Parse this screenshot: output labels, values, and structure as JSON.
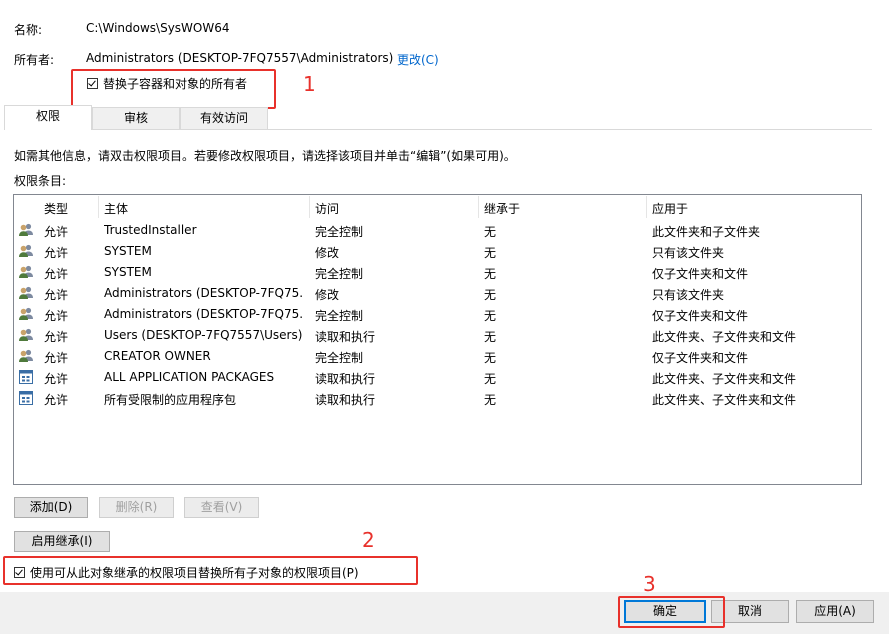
{
  "name_label": "名称:",
  "name_value": "C:\\Windows\\SysWOW64",
  "owner_label": "所有者:",
  "owner_value": "Administrators (DESKTOP-7FQ7557\\Administrators)",
  "owner_change": "更改(C)",
  "replace_owner_checkbox": "替换子容器和对象的所有者",
  "tabs": [
    "权限",
    "审核",
    "有效访问"
  ],
  "info_text": "如需其他信息，请双击权限项目。若要修改权限项目，请选择该项目并单击“编辑”(如果可用)。",
  "perm_entries_label": "权限条目:",
  "columns": [
    "类型",
    "主体",
    "访问",
    "继承于",
    "应用于"
  ],
  "rows": [
    {
      "icon": "user-group-icon",
      "type": "允许",
      "principal": "TrustedInstaller",
      "access": "完全控制",
      "inherited": "无",
      "applies": "此文件夹和子文件夹"
    },
    {
      "icon": "user-group-icon",
      "type": "允许",
      "principal": "SYSTEM",
      "access": "修改",
      "inherited": "无",
      "applies": "只有该文件夹"
    },
    {
      "icon": "user-group-icon",
      "type": "允许",
      "principal": "SYSTEM",
      "access": "完全控制",
      "inherited": "无",
      "applies": "仅子文件夹和文件"
    },
    {
      "icon": "user-group-icon",
      "type": "允许",
      "principal": "Administrators (DESKTOP-7FQ75...",
      "access": "修改",
      "inherited": "无",
      "applies": "只有该文件夹"
    },
    {
      "icon": "user-group-icon",
      "type": "允许",
      "principal": "Administrators (DESKTOP-7FQ75...",
      "access": "完全控制",
      "inherited": "无",
      "applies": "仅子文件夹和文件"
    },
    {
      "icon": "user-group-icon",
      "type": "允许",
      "principal": "Users (DESKTOP-7FQ7557\\Users)",
      "access": "读取和执行",
      "inherited": "无",
      "applies": "此文件夹、子文件夹和文件"
    },
    {
      "icon": "user-group-icon",
      "type": "允许",
      "principal": "CREATOR OWNER",
      "access": "完全控制",
      "inherited": "无",
      "applies": "仅子文件夹和文件"
    },
    {
      "icon": "app-package-icon",
      "type": "允许",
      "principal": "ALL APPLICATION PACKAGES",
      "access": "读取和执行",
      "inherited": "无",
      "applies": "此文件夹、子文件夹和文件"
    },
    {
      "icon": "app-package-icon",
      "type": "允许",
      "principal": "所有受限制的应用程序包",
      "access": "读取和执行",
      "inherited": "无",
      "applies": "此文件夹、子文件夹和文件"
    }
  ],
  "buttons": {
    "add": "添加(D)",
    "remove": "删除(R)",
    "view": "查看(V)",
    "enable_inherit": "启用继承(I)"
  },
  "replace_child_checkbox": "使用可从此对象继承的权限项目替换所有子对象的权限项目(P)",
  "footer": {
    "ok": "确定",
    "cancel": "取消",
    "apply": "应用(A)"
  },
  "annotations": [
    "1",
    "2",
    "3"
  ],
  "colors": {
    "annotation_red": "#e8312b",
    "link_blue": "#0066cc"
  }
}
